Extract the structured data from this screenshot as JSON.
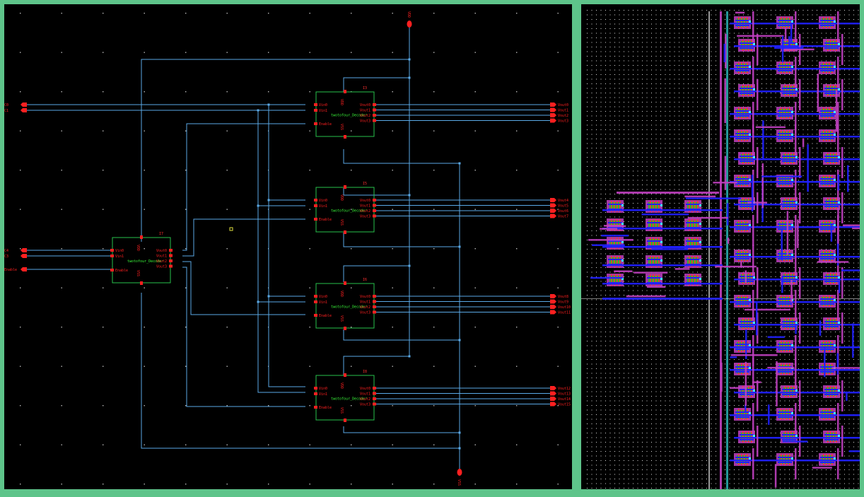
{
  "colors": {
    "frame": "#5ec48a",
    "background": "#000000",
    "wire": "#5aa9e6",
    "pin": "#ff2020",
    "instance_border": "#27c24c",
    "cell_name": "#3cff3c",
    "instance_id": "#ff3030",
    "grid_dot": "#bbbbbb",
    "metal1": "#2020ff",
    "metal2": "#c040c0",
    "poly": "#ff3030",
    "active": "#20c020",
    "contact": "#40ffff"
  },
  "schematic": {
    "supply_top": "VDD",
    "supply_bottom": "VSS",
    "top_inputs": [
      "C0",
      "C1"
    ],
    "left_inputs": [
      "C4",
      "C3"
    ],
    "enable_pin": "Enable",
    "main_decoder": {
      "id": "I7",
      "cell": "twotofour_Decoder",
      "left_pins": [
        "Vin0",
        "Vin1",
        "Enable"
      ],
      "right_pins": [
        "Vout0",
        "Vout1",
        "Vout2",
        "Vout3"
      ],
      "top_pin": "VDD",
      "bottom_pin": "VSS"
    },
    "decoders": [
      {
        "id": "I3",
        "cell": "twotofour_Decoder",
        "left_pins": [
          "Vin0",
          "Vin1",
          "Enable"
        ],
        "right_pins": [
          "Vout0",
          "Vout1",
          "Vout2",
          "Vout3"
        ],
        "top_pin": "VDD",
        "bottom_pin": "VSS",
        "outputs": [
          "Vout0",
          "Vout1",
          "Vout2",
          "Vout3"
        ]
      },
      {
        "id": "I5",
        "cell": "twotofour_Decoder",
        "left_pins": [
          "Vin0",
          "Vin1",
          "Enable"
        ],
        "right_pins": [
          "Vout0",
          "Vout1",
          "Vout2",
          "Vout3"
        ],
        "top_pin": "VDD",
        "bottom_pin": "VSS",
        "outputs": [
          "Vout4",
          "Vout5",
          "Vout6",
          "Vout7"
        ]
      },
      {
        "id": "I6",
        "cell": "twotofour_Decoder",
        "left_pins": [
          "Vin0",
          "Vin1",
          "Enable"
        ],
        "right_pins": [
          "Vout0",
          "Vout1",
          "Vout2",
          "Vout3"
        ],
        "top_pin": "VDD",
        "bottom_pin": "VSS",
        "outputs": [
          "Vout8",
          "Vout9",
          "Vout10",
          "Vout11"
        ]
      },
      {
        "id": "I8",
        "cell": "twotofour_Decoder",
        "left_pins": [
          "Vin0",
          "Vin1",
          "Enable"
        ],
        "right_pins": [
          "Vout0",
          "Vout1",
          "Vout2",
          "Vout3"
        ],
        "top_pin": "VDD",
        "bottom_pin": "VSS",
        "outputs": [
          "Vout12",
          "Vout13",
          "Vout14",
          "Vout15"
        ]
      }
    ]
  }
}
